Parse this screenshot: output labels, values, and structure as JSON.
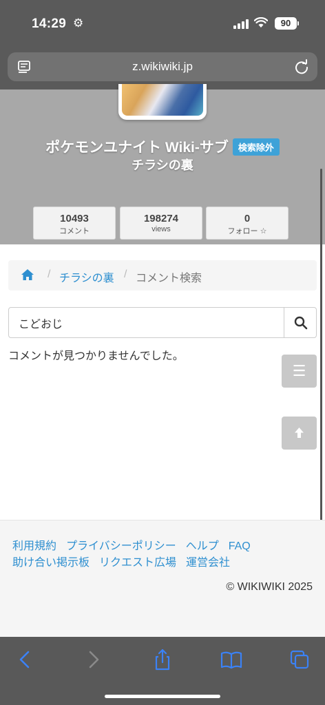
{
  "status_bar": {
    "time": "14:29",
    "battery": "90"
  },
  "browser": {
    "url": "z.wikiwiki.jp"
  },
  "header": {
    "title": "ポケモンユナイト Wiki-サブ",
    "badge": "検索除外",
    "subtitle": "チラシの裏",
    "stats": [
      {
        "value": "10493",
        "label": "コメント"
      },
      {
        "value": "198274",
        "label": "views"
      },
      {
        "value": "0",
        "label": "フォロー ☆"
      }
    ]
  },
  "breadcrumb": {
    "separator": "/",
    "link": "チラシの裏",
    "current": "コメント検索"
  },
  "search": {
    "value": "こどおじ"
  },
  "results": {
    "message": "コメントが見つかりませんでした。"
  },
  "footer": {
    "links": [
      "利用規約",
      "プライバシーポリシー",
      "ヘルプ",
      "FAQ",
      "助け合い掲示板",
      "リクエスト広場",
      "運営会社"
    ],
    "copyright": "© WIKIWIKI 2025"
  },
  "colors": {
    "accent": "#2e8fd0",
    "badge": "#3ea2d8",
    "toolbar_icon": "#3b82f6"
  },
  "icons": [
    "settings-icon",
    "signal-icon",
    "wifi-icon",
    "reader-icon",
    "reload-icon",
    "home-icon",
    "search-icon",
    "menu-icon",
    "arrow-up-icon",
    "back-icon",
    "forward-icon",
    "share-icon",
    "bookmarks-icon",
    "tabs-icon"
  ]
}
